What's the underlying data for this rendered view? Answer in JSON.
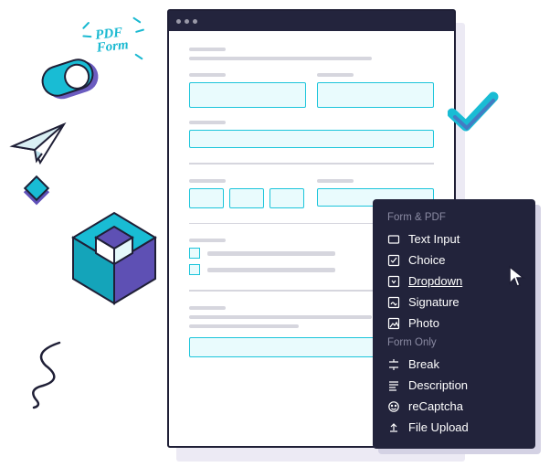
{
  "decoration": {
    "pdf_label_line1": "PDF",
    "pdf_label_line2": "Form"
  },
  "menu": {
    "section1_header": "Form & PDF",
    "section2_header": "Form Only",
    "items_s1": [
      {
        "label": "Text Input",
        "icon": "text-input-icon"
      },
      {
        "label": "Choice",
        "icon": "choice-icon"
      },
      {
        "label": "Dropdown",
        "icon": "dropdown-icon"
      },
      {
        "label": "Signature",
        "icon": "signature-icon"
      },
      {
        "label": "Photo",
        "icon": "photo-icon"
      }
    ],
    "items_s2": [
      {
        "label": "Break",
        "icon": "break-icon"
      },
      {
        "label": "Description",
        "icon": "description-icon"
      },
      {
        "label": "reCaptcha",
        "icon": "recaptcha-icon"
      },
      {
        "label": "File Upload",
        "icon": "upload-icon"
      }
    ],
    "hovered_s1_index": 2
  }
}
